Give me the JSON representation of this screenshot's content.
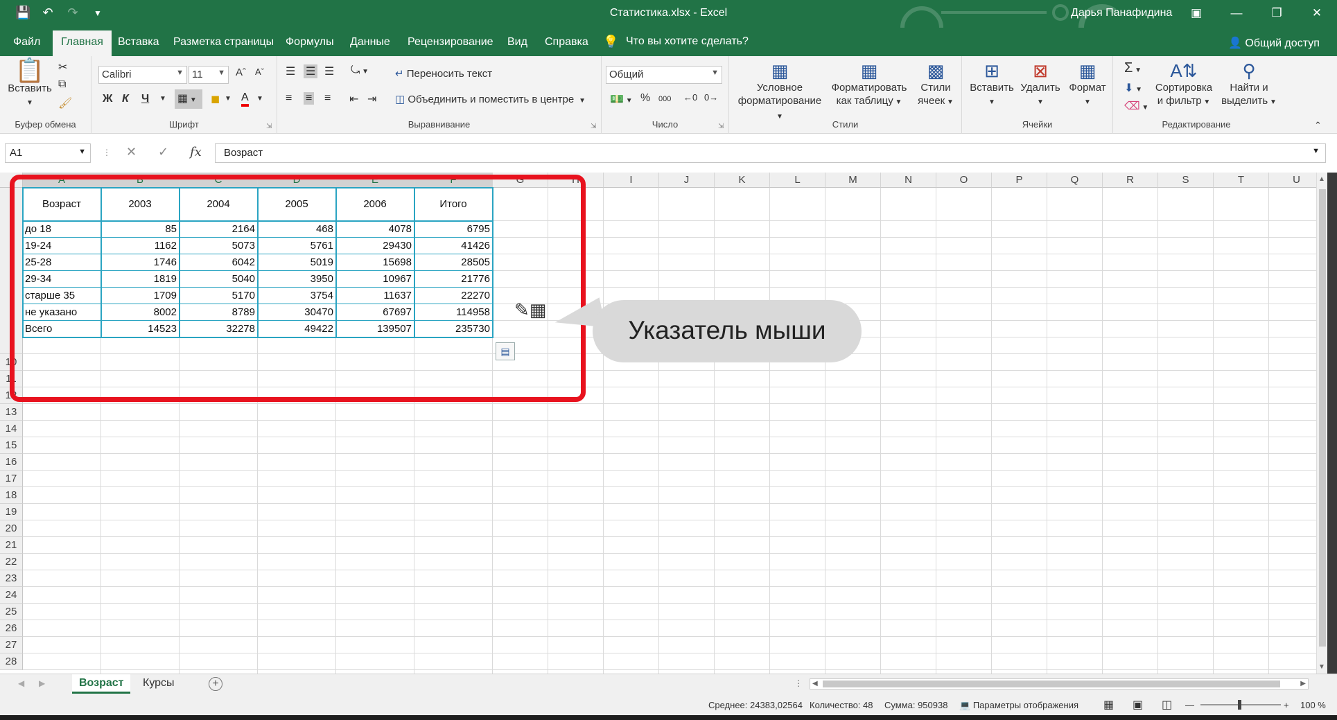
{
  "window": {
    "title": "Статистика.xlsx  -  Excel",
    "user": "Дарья Панафидина"
  },
  "tabs": {
    "file": "Файл",
    "home": "Главная",
    "insert": "Вставка",
    "page_layout": "Разметка страницы",
    "formulas": "Формулы",
    "data": "Данные",
    "review": "Рецензирование",
    "view": "Вид",
    "help": "Справка",
    "tell_me": "Что вы хотите сделать?",
    "share": "Общий доступ"
  },
  "ribbon": {
    "clipboard": {
      "paste": "Вставить",
      "label": "Буфер обмена"
    },
    "font": {
      "name": "Calibri",
      "size": "11",
      "bold": "Ж",
      "italic": "К",
      "underline": "Ч",
      "label": "Шрифт"
    },
    "alignment": {
      "wrap": "Переносить текст",
      "merge": "Объединить и поместить в центре",
      "label": "Выравнивание"
    },
    "number": {
      "format": "Общий",
      "percent": "%",
      "thousands": "000",
      "label": "Число"
    },
    "styles": {
      "conditional_l1": "Условное",
      "conditional_l2": "форматирование",
      "as_table_l1": "Форматировать",
      "as_table_l2": "как таблицу",
      "cell_styles_l1": "Стили",
      "cell_styles_l2": "ячеек",
      "label": "Стили"
    },
    "cells": {
      "insert": "Вставить",
      "delete": "Удалить",
      "format": "Формат",
      "label": "Ячейки"
    },
    "editing": {
      "sort_l1": "Сортировка",
      "sort_l2": "и фильтр",
      "find_l1": "Найти и",
      "find_l2": "выделить",
      "label": "Редактирование"
    }
  },
  "formula_bar": {
    "name_box": "A1",
    "fx": "fx",
    "content": "Возраст"
  },
  "grid": {
    "columns": [
      "A",
      "B",
      "C",
      "D",
      "E",
      "F",
      "G",
      "H",
      "I",
      "J",
      "K",
      "L",
      "M",
      "N",
      "O",
      "P",
      "Q",
      "R",
      "S",
      "T",
      "U"
    ],
    "rows": [
      "10",
      "11",
      "12",
      "13",
      "14",
      "15",
      "16",
      "17",
      "18",
      "19",
      "20",
      "21",
      "22",
      "23",
      "24",
      "25",
      "26",
      "27",
      "28"
    ],
    "table": {
      "header": [
        "Возраст",
        "2003",
        "2004",
        "2005",
        "2006",
        "Итого"
      ],
      "rows": [
        [
          "до 18",
          "85",
          "2164",
          "468",
          "4078",
          "6795"
        ],
        [
          "19-24",
          "1162",
          "5073",
          "5761",
          "29430",
          "41426"
        ],
        [
          "25-28",
          "1746",
          "6042",
          "5019",
          "15698",
          "28505"
        ],
        [
          "29-34",
          "1819",
          "5040",
          "3950",
          "10967",
          "21776"
        ],
        [
          "старше 35",
          "1709",
          "5170",
          "3754",
          "11637",
          "22270"
        ],
        [
          "не указано",
          "8002",
          "8789",
          "30470",
          "67697",
          "114958"
        ],
        [
          "Всего",
          "14523",
          "32278",
          "49422",
          "139507",
          "235730"
        ]
      ]
    }
  },
  "callout": {
    "text": "Указатель мыши"
  },
  "sheets": {
    "active": "Возраст",
    "other": "Курсы"
  },
  "status": {
    "average": "Среднее: 24383,02564",
    "count": "Количество: 48",
    "sum": "Сумма: 950938",
    "display_settings": "Параметры отображения",
    "zoom": "100 %"
  }
}
